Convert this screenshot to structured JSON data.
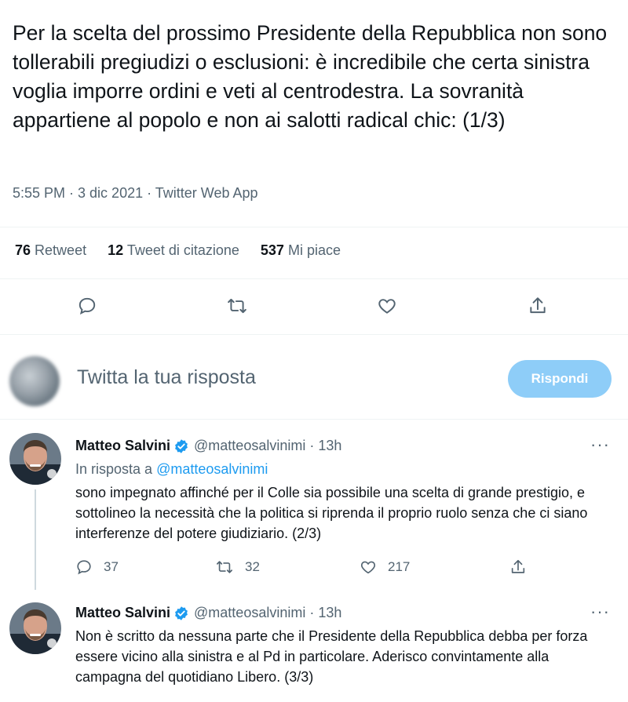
{
  "tweet": {
    "text": "Per la scelta del prossimo Presidente della Repubblica non sono tollerabili pregiudizi o esclusioni: è incredibile che certa sinistra voglia imporre ordini e veti al centrodestra. La sovranità appartiene al popolo e non ai salotti radical chic: (1/3)",
    "meta": "5:55 PM · 3 dic 2021 · Twitter Web App",
    "stats": {
      "retweets_count": "76",
      "retweets_label": "Retweet",
      "quotes_count": "12",
      "quotes_label": "Tweet di citazione",
      "likes_count": "537",
      "likes_label": "Mi piace"
    }
  },
  "reply_box": {
    "placeholder": "Twitta la tua risposta",
    "button_label": "Rispondi"
  },
  "replies": [
    {
      "name": "Matteo Salvini",
      "handle": "@matteosalvinimi · 13h",
      "replying_to_prefix": "In risposta a",
      "replying_to_handle": "@matteosalvinimi",
      "text": "sono impegnato affinché per il Colle sia possibile una scelta di grande prestigio, e sottolineo la necessità che la politica si riprenda il proprio ruolo senza che ci siano interferenze del potere giudiziario. (2/3)",
      "reply_count": "37",
      "retweet_count": "32",
      "like_count": "217",
      "more": "···"
    },
    {
      "name": "Matteo Salvini",
      "handle": "@matteosalvinimi · 13h",
      "text": "Non è scritto da nessuna parte che il Presidente della Repubblica debba per forza essere vicino alla sinistra e al Pd in particolare. Aderisco convintamente alla campagna del quotidiano Libero. (3/3)",
      "more": "···"
    }
  ],
  "icons": [
    "reply-icon",
    "retweet-icon",
    "like-icon",
    "share-icon",
    "verified-badge-icon",
    "more-icon"
  ],
  "colors": {
    "accent": "#1d9bf0",
    "button_disabled": "#8ecdf8",
    "secondary_text": "#536471",
    "divider": "#eff3f4"
  }
}
